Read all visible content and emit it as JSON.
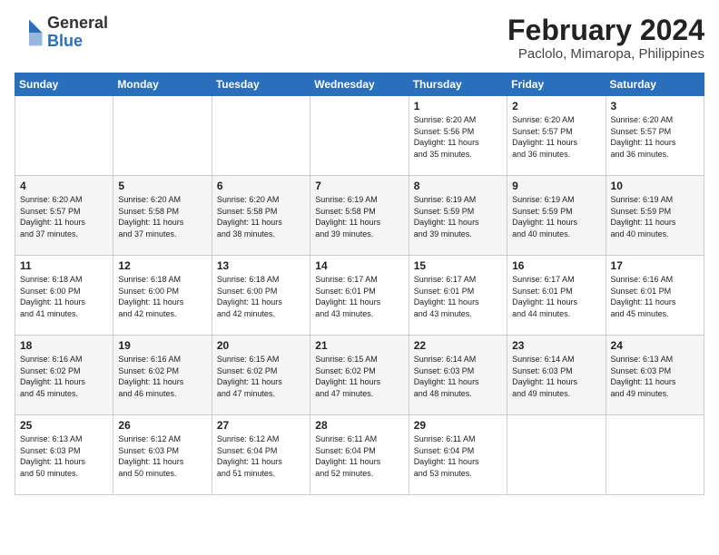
{
  "header": {
    "logo_general": "General",
    "logo_blue": "Blue",
    "month_year": "February 2024",
    "location": "Paclolo, Mimaropa, Philippines"
  },
  "days_of_week": [
    "Sunday",
    "Monday",
    "Tuesday",
    "Wednesday",
    "Thursday",
    "Friday",
    "Saturday"
  ],
  "weeks": [
    [
      {
        "day": "",
        "info": ""
      },
      {
        "day": "",
        "info": ""
      },
      {
        "day": "",
        "info": ""
      },
      {
        "day": "",
        "info": ""
      },
      {
        "day": "1",
        "info": "Sunrise: 6:20 AM\nSunset: 5:56 PM\nDaylight: 11 hours\nand 35 minutes."
      },
      {
        "day": "2",
        "info": "Sunrise: 6:20 AM\nSunset: 5:57 PM\nDaylight: 11 hours\nand 36 minutes."
      },
      {
        "day": "3",
        "info": "Sunrise: 6:20 AM\nSunset: 5:57 PM\nDaylight: 11 hours\nand 36 minutes."
      }
    ],
    [
      {
        "day": "4",
        "info": "Sunrise: 6:20 AM\nSunset: 5:57 PM\nDaylight: 11 hours\nand 37 minutes."
      },
      {
        "day": "5",
        "info": "Sunrise: 6:20 AM\nSunset: 5:58 PM\nDaylight: 11 hours\nand 37 minutes."
      },
      {
        "day": "6",
        "info": "Sunrise: 6:20 AM\nSunset: 5:58 PM\nDaylight: 11 hours\nand 38 minutes."
      },
      {
        "day": "7",
        "info": "Sunrise: 6:19 AM\nSunset: 5:58 PM\nDaylight: 11 hours\nand 39 minutes."
      },
      {
        "day": "8",
        "info": "Sunrise: 6:19 AM\nSunset: 5:59 PM\nDaylight: 11 hours\nand 39 minutes."
      },
      {
        "day": "9",
        "info": "Sunrise: 6:19 AM\nSunset: 5:59 PM\nDaylight: 11 hours\nand 40 minutes."
      },
      {
        "day": "10",
        "info": "Sunrise: 6:19 AM\nSunset: 5:59 PM\nDaylight: 11 hours\nand 40 minutes."
      }
    ],
    [
      {
        "day": "11",
        "info": "Sunrise: 6:18 AM\nSunset: 6:00 PM\nDaylight: 11 hours\nand 41 minutes."
      },
      {
        "day": "12",
        "info": "Sunrise: 6:18 AM\nSunset: 6:00 PM\nDaylight: 11 hours\nand 42 minutes."
      },
      {
        "day": "13",
        "info": "Sunrise: 6:18 AM\nSunset: 6:00 PM\nDaylight: 11 hours\nand 42 minutes."
      },
      {
        "day": "14",
        "info": "Sunrise: 6:17 AM\nSunset: 6:01 PM\nDaylight: 11 hours\nand 43 minutes."
      },
      {
        "day": "15",
        "info": "Sunrise: 6:17 AM\nSunset: 6:01 PM\nDaylight: 11 hours\nand 43 minutes."
      },
      {
        "day": "16",
        "info": "Sunrise: 6:17 AM\nSunset: 6:01 PM\nDaylight: 11 hours\nand 44 minutes."
      },
      {
        "day": "17",
        "info": "Sunrise: 6:16 AM\nSunset: 6:01 PM\nDaylight: 11 hours\nand 45 minutes."
      }
    ],
    [
      {
        "day": "18",
        "info": "Sunrise: 6:16 AM\nSunset: 6:02 PM\nDaylight: 11 hours\nand 45 minutes."
      },
      {
        "day": "19",
        "info": "Sunrise: 6:16 AM\nSunset: 6:02 PM\nDaylight: 11 hours\nand 46 minutes."
      },
      {
        "day": "20",
        "info": "Sunrise: 6:15 AM\nSunset: 6:02 PM\nDaylight: 11 hours\nand 47 minutes."
      },
      {
        "day": "21",
        "info": "Sunrise: 6:15 AM\nSunset: 6:02 PM\nDaylight: 11 hours\nand 47 minutes."
      },
      {
        "day": "22",
        "info": "Sunrise: 6:14 AM\nSunset: 6:03 PM\nDaylight: 11 hours\nand 48 minutes."
      },
      {
        "day": "23",
        "info": "Sunrise: 6:14 AM\nSunset: 6:03 PM\nDaylight: 11 hours\nand 49 minutes."
      },
      {
        "day": "24",
        "info": "Sunrise: 6:13 AM\nSunset: 6:03 PM\nDaylight: 11 hours\nand 49 minutes."
      }
    ],
    [
      {
        "day": "25",
        "info": "Sunrise: 6:13 AM\nSunset: 6:03 PM\nDaylight: 11 hours\nand 50 minutes."
      },
      {
        "day": "26",
        "info": "Sunrise: 6:12 AM\nSunset: 6:03 PM\nDaylight: 11 hours\nand 50 minutes."
      },
      {
        "day": "27",
        "info": "Sunrise: 6:12 AM\nSunset: 6:04 PM\nDaylight: 11 hours\nand 51 minutes."
      },
      {
        "day": "28",
        "info": "Sunrise: 6:11 AM\nSunset: 6:04 PM\nDaylight: 11 hours\nand 52 minutes."
      },
      {
        "day": "29",
        "info": "Sunrise: 6:11 AM\nSunset: 6:04 PM\nDaylight: 11 hours\nand 53 minutes."
      },
      {
        "day": "",
        "info": ""
      },
      {
        "day": "",
        "info": ""
      }
    ]
  ]
}
